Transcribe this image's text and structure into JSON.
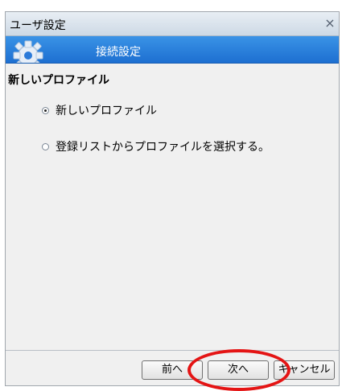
{
  "window": {
    "title": "ユーザ設定",
    "close_label": "×"
  },
  "banner": {
    "icon": "gear-icon",
    "title": "接続設定"
  },
  "main": {
    "heading": "新しいプロファイル",
    "options": [
      {
        "label": "新しいプロファイル",
        "selected": true
      },
      {
        "label": "登録リストからプロファイルを選択する。",
        "selected": false
      }
    ]
  },
  "footer": {
    "prev_label": "前へ",
    "next_label": "次へ",
    "cancel_label": "キャンセル"
  },
  "colors": {
    "banner": "#1d6fd1",
    "highlight": "#e41414"
  }
}
